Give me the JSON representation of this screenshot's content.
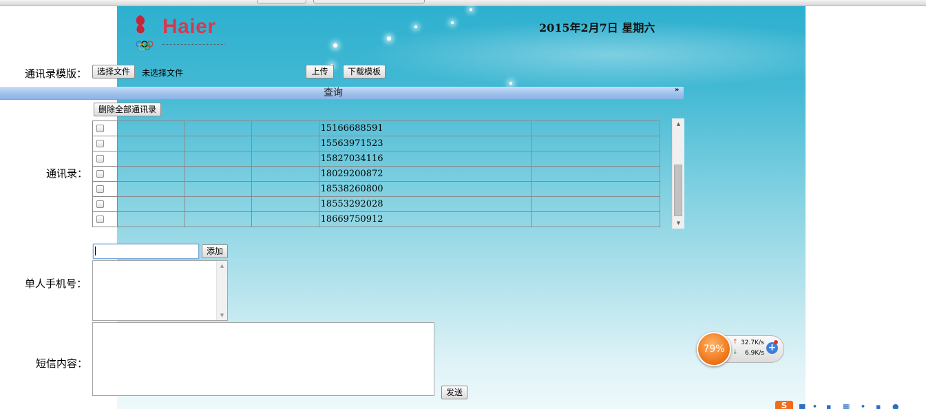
{
  "header": {
    "logo_brand": "Haier",
    "date": "2015年2月7日  星期六"
  },
  "template_row": {
    "label": "通讯录模版：",
    "choose_file_label": "选择文件",
    "no_file_text": "未选择文件",
    "upload_label": "上传",
    "download_template_label": "下载模板"
  },
  "query_bar": {
    "title": "查询",
    "chevron": "»"
  },
  "contacts": {
    "delete_all_label": "删除全部通讯录",
    "label": "通讯录：",
    "rows": [
      {
        "phone": "15166688591"
      },
      {
        "phone": "15563971523"
      },
      {
        "phone": "15827034116"
      },
      {
        "phone": "18029200872"
      },
      {
        "phone": "18538260800"
      },
      {
        "phone": "18553292028"
      },
      {
        "phone": "18669750912"
      }
    ]
  },
  "single_phone": {
    "label": "单人手机号：",
    "input_value": "",
    "add_label": "添加"
  },
  "sms": {
    "label": "短信内容：",
    "content": "",
    "send_label": "发送"
  },
  "net_widget": {
    "percent": "79%",
    "upload_speed": "32.7K/s",
    "download_speed": "6.9K/s",
    "up_arrow": "↑",
    "down_arrow": "↓",
    "plus": "+"
  },
  "tray": {
    "logo": "S"
  },
  "colors": {
    "banner_top": "#2db0cf",
    "banner_bottom": "#eef9fb",
    "brand_red": "#d63a4f",
    "widget_orange": "#f07b1f"
  }
}
